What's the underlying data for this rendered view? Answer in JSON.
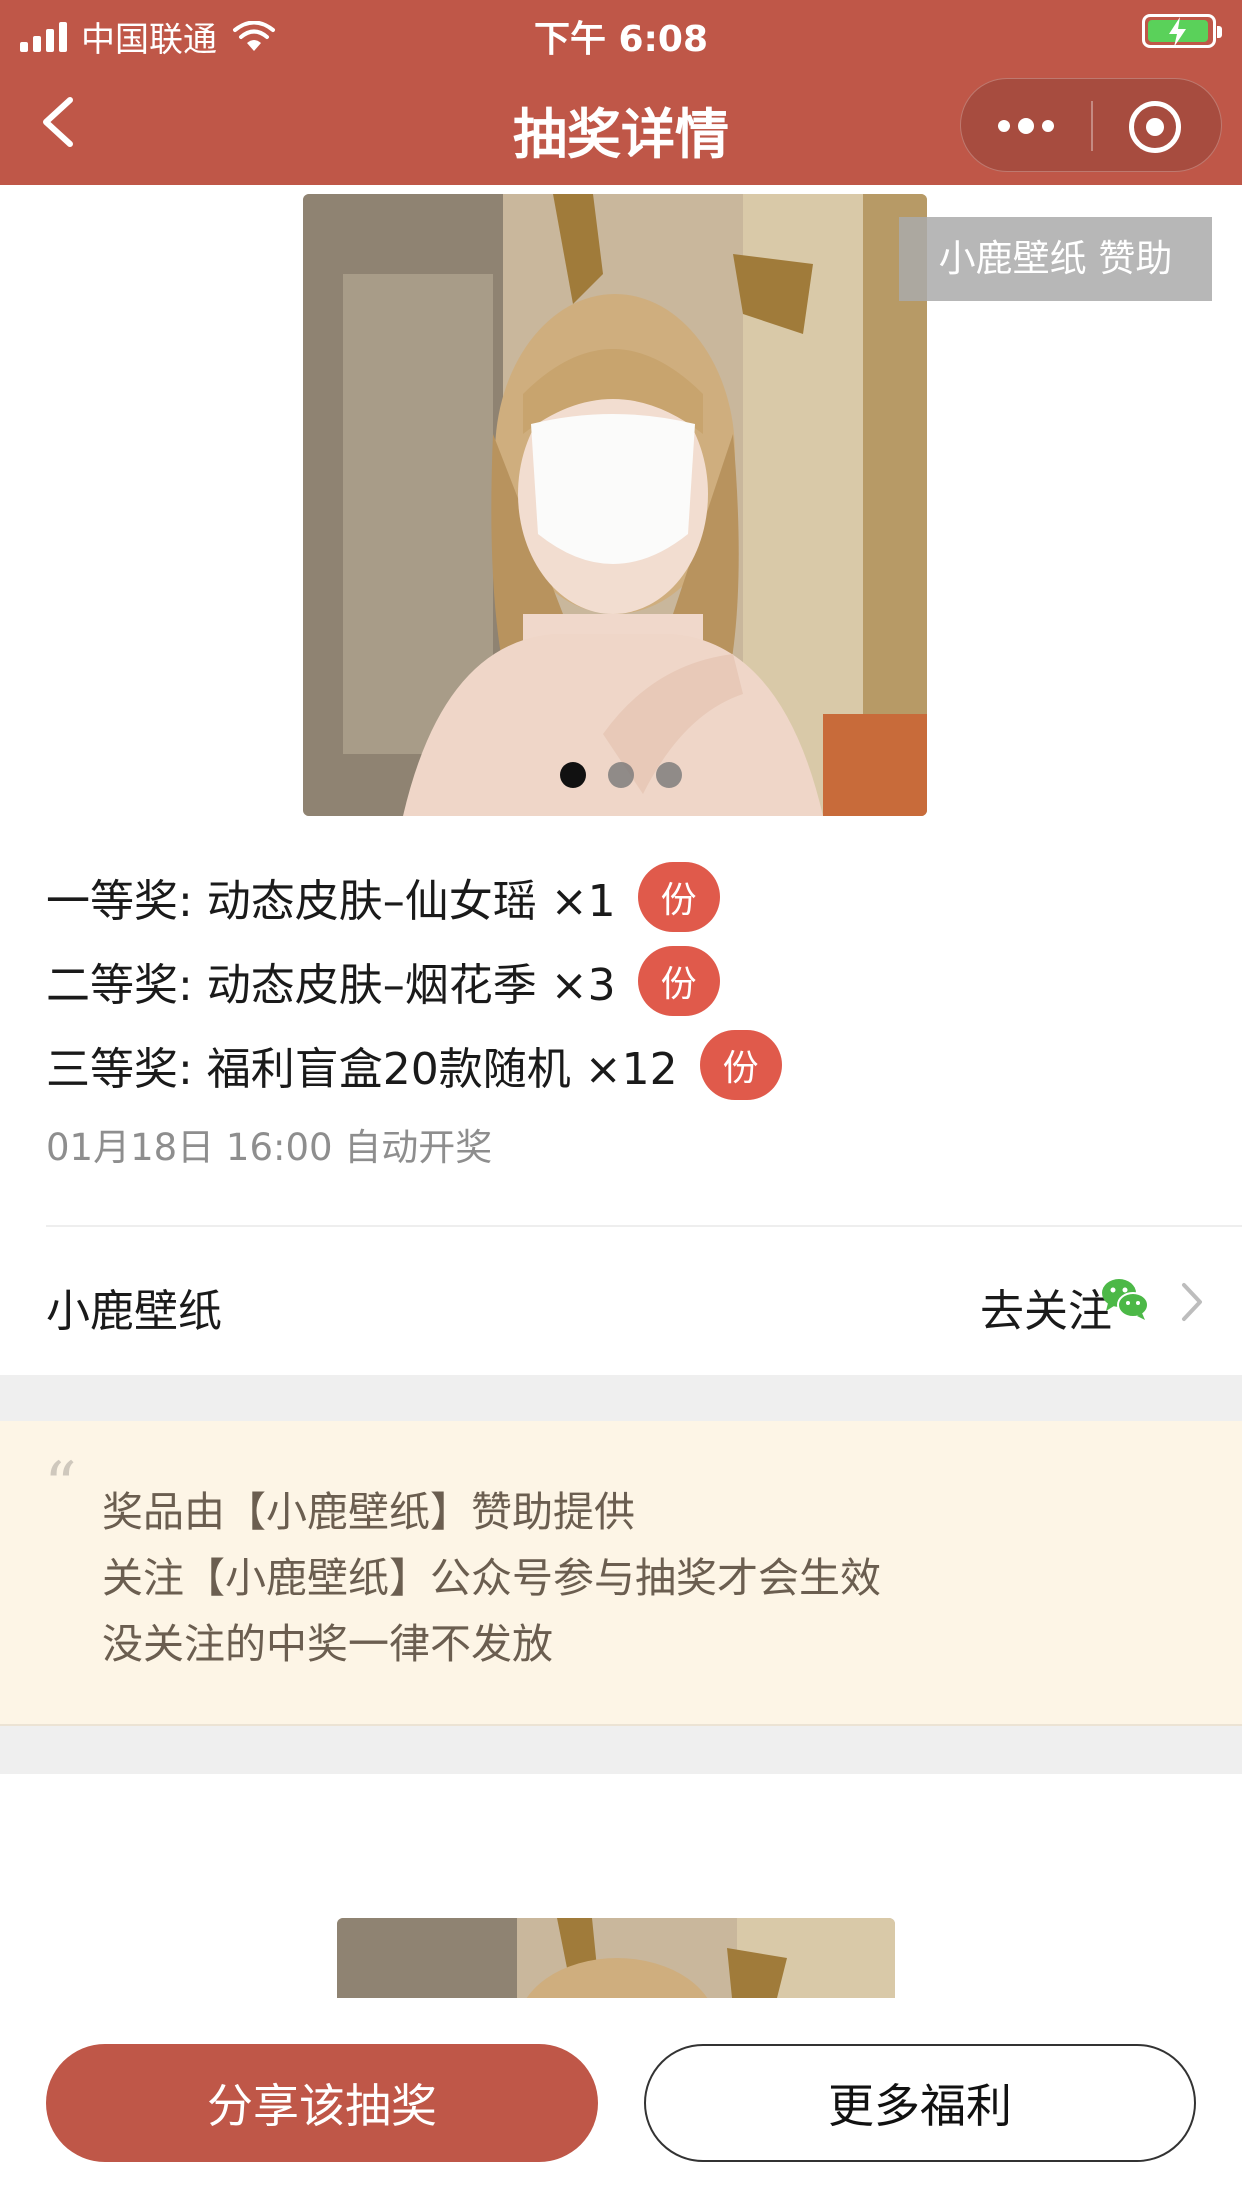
{
  "status_bar": {
    "carrier": "中国联通",
    "time": "下午 6:08"
  },
  "nav": {
    "title": "抽奖详情"
  },
  "carousel": {
    "sponsor_tag": "小鹿壁纸 赞助",
    "slide_count": 3,
    "active_slide": 1
  },
  "prizes": [
    {
      "label": "一等奖: 动态皮肤–仙女瑶 ×1",
      "badge": "份"
    },
    {
      "label": "二等奖: 动态皮肤–烟花季 ×3",
      "badge": "份"
    },
    {
      "label": "三等奖: 福利盲盒20款随机 ×12",
      "badge": "份"
    }
  ],
  "draw_time": "01月18日 16:00 自动开奖",
  "account": {
    "name": "小鹿壁纸",
    "follow_label": "去关注"
  },
  "notice": {
    "lines": [
      "奖品由【小鹿壁纸】赞助提供",
      "关注【小鹿壁纸】公众号参与抽奖才会生效",
      "没关注的中奖一律不发放"
    ]
  },
  "buttons": {
    "share": "分享该抽奖",
    "more": "更多福利"
  },
  "colors": {
    "brand": "#bf5748",
    "badge": "#e05a4b",
    "notice_bg": "#fdf5e6",
    "wechat_green": "#4cb847"
  }
}
